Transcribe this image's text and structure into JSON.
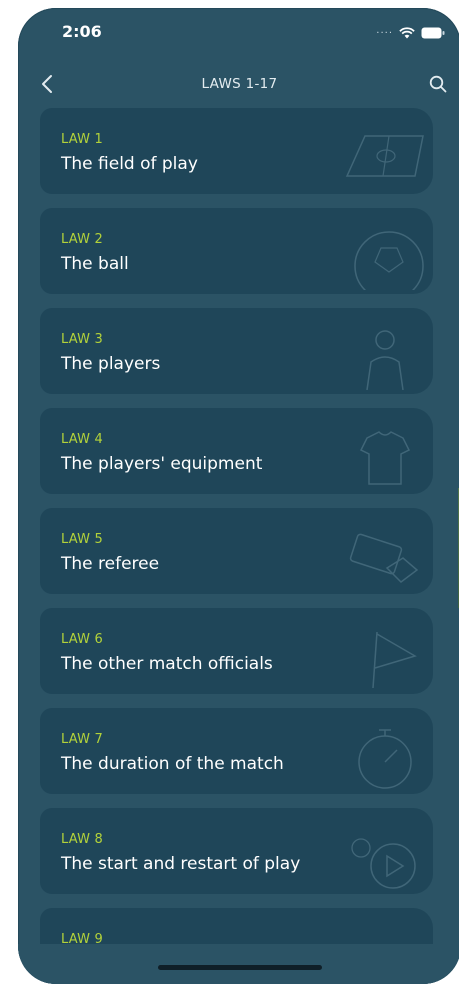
{
  "status_bar": {
    "time": "2:06"
  },
  "nav": {
    "title": "LAWS 1-17"
  },
  "laws": [
    {
      "number": "LAW 1",
      "title": "The field of play",
      "icon": "field-icon"
    },
    {
      "number": "LAW 2",
      "title": "The ball",
      "icon": "ball-icon"
    },
    {
      "number": "LAW 3",
      "title": "The players",
      "icon": "player-icon"
    },
    {
      "number": "LAW 4",
      "title": "The players' equipment",
      "icon": "shirt-icon"
    },
    {
      "number": "LAW 5",
      "title": "The referee",
      "icon": "referee-cards-icon"
    },
    {
      "number": "LAW 6",
      "title": "The other match officials",
      "icon": "flag-icon"
    },
    {
      "number": "LAW 7",
      "title": "The duration of the match",
      "icon": "stopwatch-icon"
    },
    {
      "number": "LAW 8",
      "title": "The start and restart of play",
      "icon": "kickoff-icon"
    },
    {
      "number": "LAW 9",
      "title": "",
      "icon": ""
    }
  ],
  "colors": {
    "background": "#2b5365",
    "card": "#1f4659",
    "accent": "#b3d23a",
    "text": "#ffffff"
  }
}
